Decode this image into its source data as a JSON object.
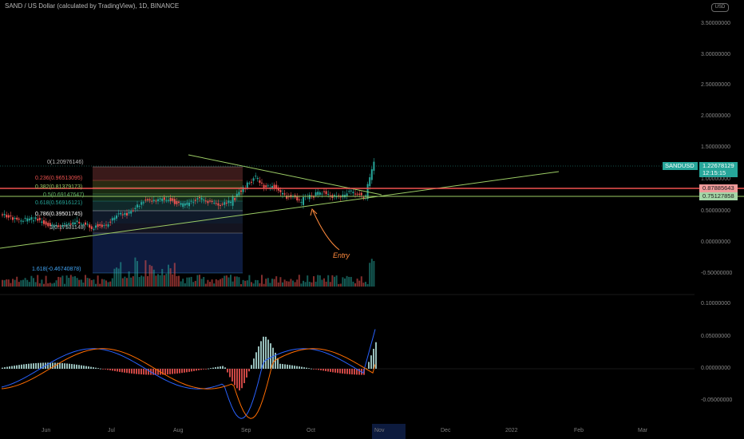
{
  "header": {
    "title": "SAND / US Dollar (calculated by TradingView), 1D, BINANCE",
    "currency_button": "USD"
  },
  "price_axis": [
    "3.50000000",
    "3.00000000",
    "2.50000000",
    "2.00000000",
    "1.50000000",
    "1.00000000",
    "0.50000000",
    "0.00000000",
    "-0.50000000"
  ],
  "macd_axis": [
    "0.10000000",
    "0.05000000",
    "0.00000000",
    "-0.05000000"
  ],
  "time_axis": [
    "Jun",
    "Jul",
    "Aug",
    "Sep",
    "Oct",
    "Nov",
    "Dec",
    "2022",
    "Feb",
    "Mar"
  ],
  "fib_levels": [
    {
      "label": "0(1.20976146)",
      "color": "#bdbdbd"
    },
    {
      "label": "0.236(0.96513095)",
      "color": "#ef5350"
    },
    {
      "label": "0.382(0.81379173)",
      "color": "#9ccc65"
    },
    {
      "label": "0.5(0.69147647)",
      "color": "#66bb6a"
    },
    {
      "label": "0.618(0.56916121)",
      "color": "#26a69a"
    },
    {
      "label": "0.786(0.39501745)",
      "color": "#ffffff"
    },
    {
      "label": "1(0.17531148)",
      "color": "#bdbdbd"
    },
    {
      "label": "1.618(-0.46740878)",
      "color": "#42a5f5"
    }
  ],
  "tags": {
    "symbol": "SANDUSD",
    "price": "1.22678129",
    "countdown": "12:15:15",
    "resistance": "0.87885643",
    "support": "0.75127858"
  },
  "annotation": "Entry",
  "colors": {
    "up": "#26a69a",
    "down": "#ef5350",
    "trendline": "#9ccc65",
    "horizontal_red": "#ef5350",
    "macd": "#2962ff",
    "signal": "#ff6d00",
    "fib_box": "#0d1b3e"
  }
}
